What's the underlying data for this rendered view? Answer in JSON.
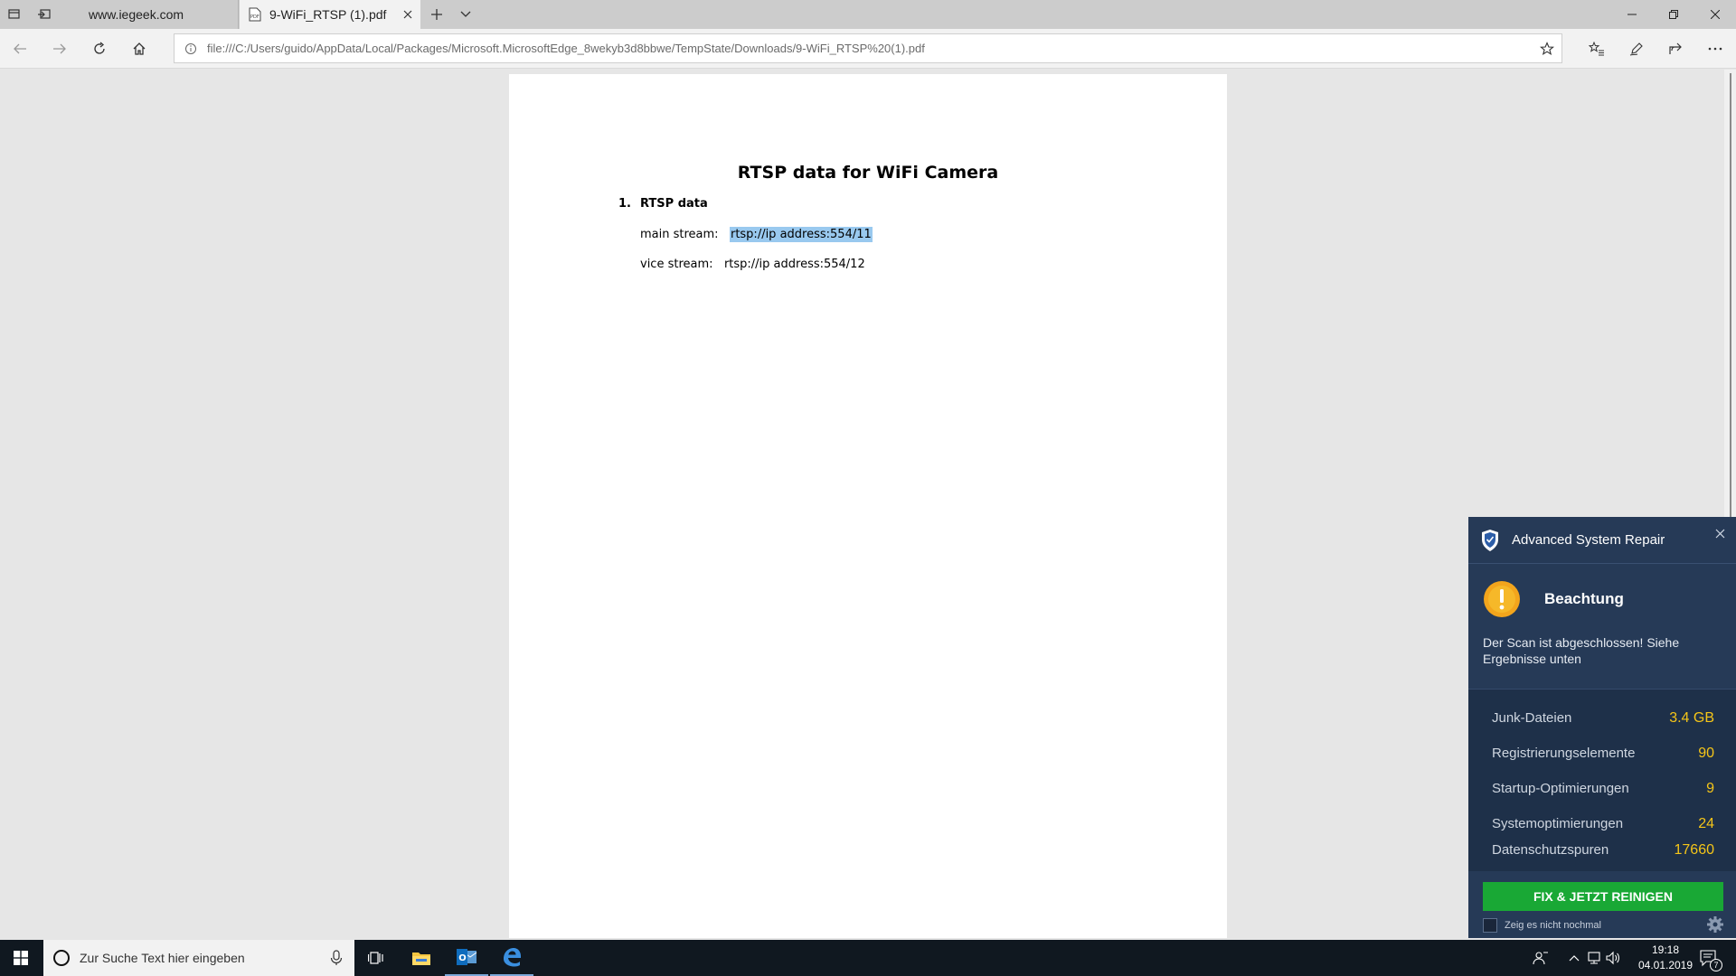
{
  "browser": {
    "tabs": [
      {
        "label": "www.iegeek.com"
      },
      {
        "label": "9-WiFi_RTSP (1).pdf"
      }
    ],
    "url": "file:///C:/Users/guido/AppData/Local/Packages/Microsoft.MicrosoftEdge_8wekyb3d8bbwe/TempState/Downloads/9-WiFi_RTSP%20(1).pdf"
  },
  "document": {
    "title": "RTSP data for WiFi Camera",
    "section_number": "1.",
    "section_title": "RTSP data",
    "main_stream_label": "main stream:",
    "main_stream_value": "rtsp://ip address:554/11",
    "vice_stream_label": "vice stream:",
    "vice_stream_value": "rtsp://ip address:554/12"
  },
  "popup": {
    "title": "Advanced System Repair",
    "heading": "Beachtung",
    "message": "Der Scan ist abgeschlossen! Siehe Ergebnisse unten",
    "results": [
      {
        "name": "Junk-Dateien",
        "value": "3.4 GB"
      },
      {
        "name": "Registrierungselemente",
        "value": "90"
      },
      {
        "name": "Startup-Optimierungen",
        "value": "9"
      },
      {
        "name": "Systemoptimierungen",
        "value": "24"
      },
      {
        "name": "Datenschutzspuren",
        "value": "17660"
      }
    ],
    "fix_button": "FIX & JETZT REINIGEN",
    "dont_show": "Zeig es nicht nochmal",
    "colors": {
      "background": "#263a57",
      "value": "#f5c518",
      "button": "#19a835"
    }
  },
  "taskbar": {
    "search_placeholder": "Zur Suche Text hier eingeben",
    "time": "19:18",
    "date": "04.01.2019",
    "notifications_count": "7"
  }
}
